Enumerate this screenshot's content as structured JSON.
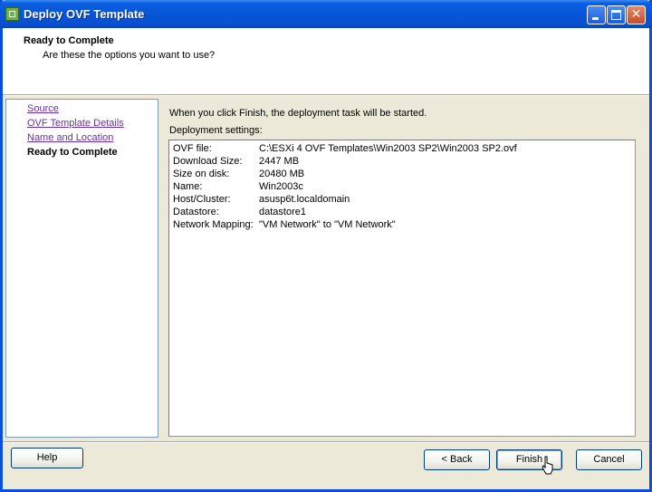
{
  "window": {
    "title": "Deploy OVF Template",
    "controls": [
      "minimize",
      "maximize",
      "close"
    ],
    "close_glyph": "✕"
  },
  "header": {
    "title": "Ready to Complete",
    "subtitle": "Are these the options you want to use?"
  },
  "nav": {
    "items": [
      {
        "label": "Source",
        "state": "visited-link"
      },
      {
        "label": "OVF Template Details",
        "state": "visited-link"
      },
      {
        "label": "Name and Location",
        "state": "visited-link"
      },
      {
        "label": "Ready to Complete",
        "state": "current"
      }
    ]
  },
  "main": {
    "intro": "When you click Finish, the deployment task will be started.",
    "settings_label": "Deployment settings:",
    "settings": [
      {
        "key": "OVF file:",
        "value": "C:\\ESXi 4 OVF Templates\\Win2003 SP2\\Win2003 SP2.ovf"
      },
      {
        "key": "Download Size:",
        "value": "2447 MB"
      },
      {
        "key": "Size on disk:",
        "value": "20480 MB"
      },
      {
        "key": "Name:",
        "value": "Win2003c"
      },
      {
        "key": "Host/Cluster:",
        "value": "asusp6t.localdomain"
      },
      {
        "key": "Datastore:",
        "value": "datastore1"
      },
      {
        "key": "Network Mapping:",
        "value": "\"VM Network\" to \"VM Network\""
      }
    ]
  },
  "buttons": {
    "help": "Help",
    "back": "< Back",
    "finish": "Finish",
    "cancel": "Cancel"
  },
  "colors": {
    "titlebar": "#0755d8",
    "link_visited": "#6a2fa8",
    "window_bg": "#ece9d8"
  }
}
